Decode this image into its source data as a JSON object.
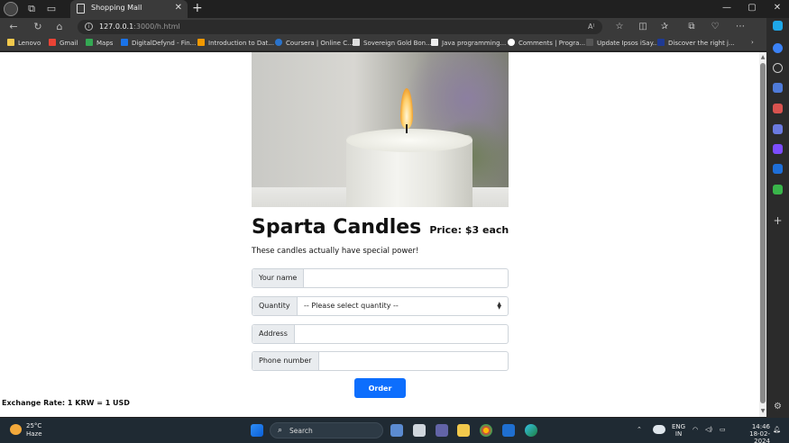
{
  "browser": {
    "tab_title": "Shopping Mall",
    "url_host": "127.0.0.1",
    "url_rest": ":3000/h.html",
    "bookmarks": [
      {
        "label": "Lenovo",
        "color": "#f2c94c"
      },
      {
        "label": "Gmail",
        "color": "#ea4335"
      },
      {
        "label": "Maps",
        "color": "#34a853"
      },
      {
        "label": "DigitalDefynd - Fin...",
        "color": "#1a73e8"
      },
      {
        "label": "Introduction to Dat...",
        "color": "#f29900"
      },
      {
        "label": "Coursera | Online C...",
        "color": "#2a73cc"
      },
      {
        "label": "Sovereign Gold Bon...",
        "color": "#dddddd"
      },
      {
        "label": "Java programming...",
        "color": "#eeeeee"
      },
      {
        "label": "Comments | Progra...",
        "color": "#ffffff"
      },
      {
        "label": "Update Ipsos iSay...",
        "color": "#555555"
      },
      {
        "label": "Discover the right j...",
        "color": "#1f3a93"
      }
    ]
  },
  "page": {
    "title": "Sparta Candles",
    "price": "Price: $3 each",
    "description": "These candles actually have special power!",
    "form": {
      "name_label": "Your name",
      "quantity_label": "Quantity",
      "quantity_selected": "-- Please select quantity --",
      "address_label": "Address",
      "phone_label": "Phone number",
      "order_button": "Order"
    },
    "exchange_rate": "Exchange Rate: 1 KRW = 1 USD",
    "accent_color": "#0d6efd"
  },
  "taskbar": {
    "temperature": "25°C",
    "weather": "Haze",
    "search_label": "Search",
    "lang_top": "ENG",
    "lang_bottom": "IN",
    "time": "14:46",
    "date": "18-02-2024"
  }
}
